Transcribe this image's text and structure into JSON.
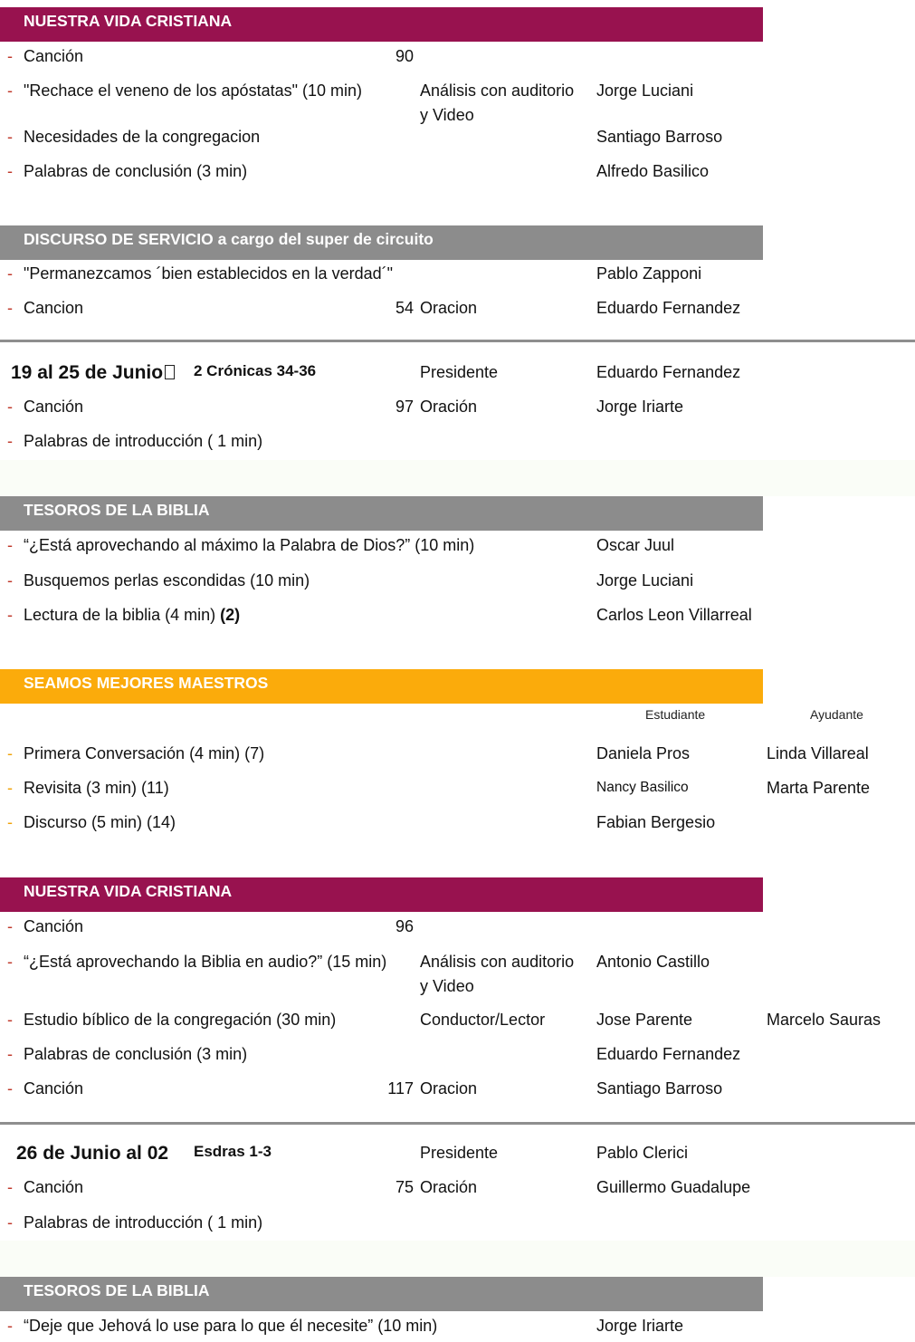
{
  "block_a": {
    "band": "NUESTRA VIDA CRISTIANA",
    "rows": [
      {
        "item": "Canción",
        "num": "90"
      },
      {
        "item": "\"Rechace el veneno de los apóstatas\" (10 min)",
        "mid1": "Análisis con auditorio",
        "mid2": "y Video",
        "name": "Jorge Luciani"
      },
      {
        "item": "Necesidades de la congregacion",
        "name": "Santiago Barroso"
      },
      {
        "item": "Palabras de conclusión (3 min)",
        "name": "Alfredo Basilico"
      }
    ]
  },
  "block_b": {
    "band": "DISCURSO DE SERVICIO a cargo del super de circuito",
    "rows": [
      {
        "item": "\"Permanezcamos ´bien establecidos en la verdad´\"",
        "name": "Pablo Zapponi"
      },
      {
        "item": "Cancion",
        "num": "54",
        "mid": "Oracion",
        "name": "Eduardo Fernandez"
      }
    ]
  },
  "week1": {
    "title": "19 al 25 de Junio",
    "marker": "",
    "reading": "2 Crónicas 34-36",
    "role": "Presidente",
    "name": "Eduardo Fernandez",
    "rows": [
      {
        "item": "Canción",
        "num": "97",
        "mid": "Oración",
        "name": "Jorge Iriarte"
      },
      {
        "item": "Palabras de introducción ( 1 min)"
      }
    ],
    "tesoros": {
      "band": "TESOROS DE LA BIBLIA",
      "rows": [
        {
          "item": "“¿Está aprovechando al máximo la Palabra de Dios?” (10 min)",
          "name": "Oscar Juul"
        },
        {
          "item": "Busquemos perlas escondidas (10 min)",
          "name": "Jorge Luciani"
        },
        {
          "item": "Lectura de la biblia (4 min)",
          "item_bold": "(2)",
          "name": "Carlos Leon Villarreal"
        }
      ]
    },
    "maestros": {
      "band": "SEAMOS MEJORES MAESTROS",
      "col_student": "Estudiante",
      "col_helper": "Ayudante",
      "rows": [
        {
          "item": "Primera Conversación (4 min) (7)",
          "name": "Daniela Pros",
          "helper": "Linda Villareal"
        },
        {
          "item": "Revisita (3 min) (11)",
          "name": "Nancy Basilico",
          "helper": "Marta Parente"
        },
        {
          "item": "Discurso (5 min) (14)",
          "name": "Fabian Bergesio"
        }
      ]
    },
    "vida": {
      "band": "NUESTRA VIDA CRISTIANA",
      "rows": [
        {
          "item": "Canción",
          "num": "96"
        },
        {
          "item": "“¿Está aprovechando la Biblia en audio?” (15 min)",
          "mid1": "Análisis con auditorio",
          "mid2": "y Video",
          "name": "Antonio Castillo"
        },
        {
          "item": "Estudio bíblico de la congregación (30 min)",
          "mid": "Conductor/Lector",
          "name": "Jose Parente",
          "helper": "Marcelo Sauras"
        },
        {
          "item": "Palabras de conclusión (3 min)",
          "name": "Eduardo Fernandez"
        },
        {
          "item": "Canción",
          "num": "117",
          "mid": "Oracion",
          "name": "Santiago Barroso"
        }
      ]
    }
  },
  "week2": {
    "title": "26 de Junio al 02",
    "reading": "Esdras 1-3",
    "role": "Presidente",
    "name": "Pablo Clerici",
    "rows": [
      {
        "item": "Canción",
        "num": "75",
        "mid": "Oración",
        "name": "Guillermo Guadalupe"
      },
      {
        "item": "Palabras de introducción ( 1 min)"
      }
    ],
    "tesoros": {
      "band": "TESOROS DE LA BIBLIA",
      "rows": [
        {
          "item": "“Deje que Jehová lo use para lo que él necesite” (10 min)",
          "name": "Jorge Iriarte"
        }
      ]
    }
  },
  "colors": {
    "purple": "#98124f",
    "gray": "#8c8c8c",
    "orange": "#fbab0b",
    "dash": "#c0392b",
    "dash_gold": "#f0a30a",
    "rule": "#8e8e8e"
  }
}
